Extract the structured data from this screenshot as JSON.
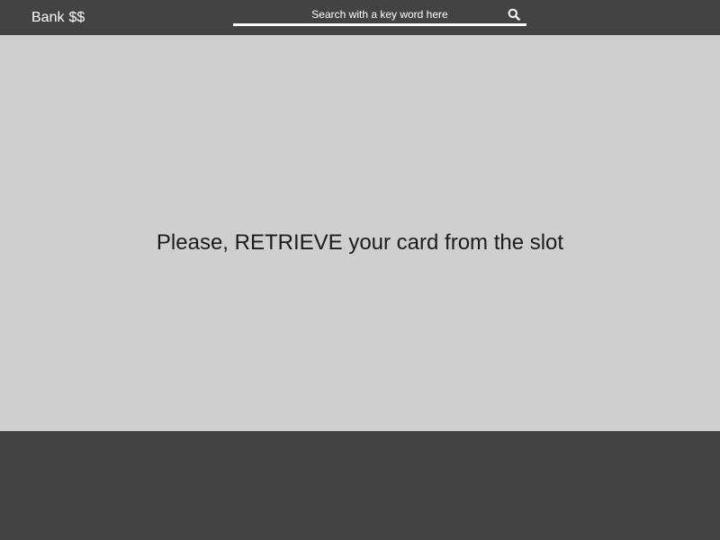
{
  "header": {
    "brand_name": "Bank",
    "brand_symbol": "$$",
    "search": {
      "placeholder": "Search with a key word here",
      "value": "",
      "icon": "search-icon"
    }
  },
  "main": {
    "message": "Please, RETRIEVE your card from the slot"
  },
  "colors": {
    "bar_background": "#434343",
    "content_background": "#cfcfcf",
    "text_light": "#ffffff",
    "text_dark": "#1c1c1c"
  }
}
